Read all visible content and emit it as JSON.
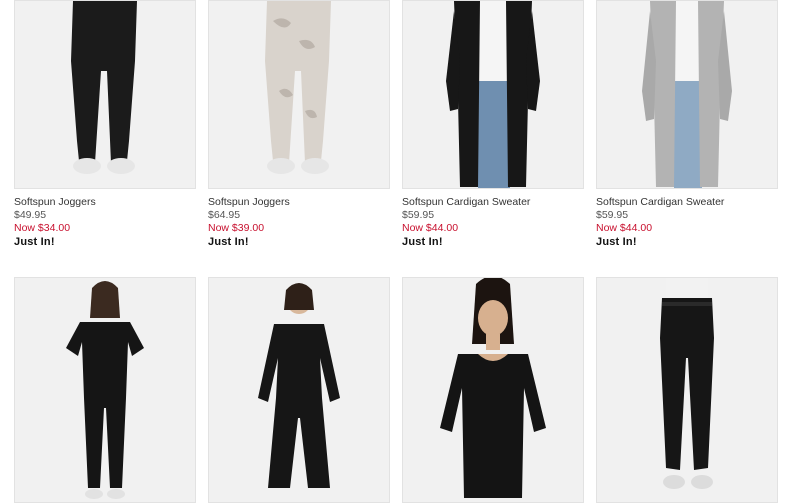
{
  "products_row1": [
    {
      "name": "Softspun Joggers",
      "price": "$49.95",
      "sale": "Now $34.00",
      "badge": "Just In!",
      "icon": "black-joggers-icon"
    },
    {
      "name": "Softspun Joggers",
      "price": "$64.95",
      "sale": "Now $39.00",
      "badge": "Just In!",
      "icon": "camo-joggers-icon"
    },
    {
      "name": "Softspun Cardigan Sweater",
      "price": "$59.95",
      "sale": "Now $44.00",
      "badge": "Just In!",
      "icon": "black-cardigan-icon"
    },
    {
      "name": "Softspun Cardigan Sweater",
      "price": "$59.95",
      "sale": "Now $44.00",
      "badge": "Just In!",
      "icon": "grey-cardigan-icon"
    }
  ],
  "products_row2": [
    {
      "icon": "short-sleeve-jumpsuit-icon"
    },
    {
      "icon": "long-sleeve-jumpsuit-icon"
    },
    {
      "icon": "black-top-icon"
    },
    {
      "icon": "black-pants-icon"
    }
  ],
  "colors": {
    "sale": "#c8102e",
    "image_bg": "#f1f1f1"
  }
}
